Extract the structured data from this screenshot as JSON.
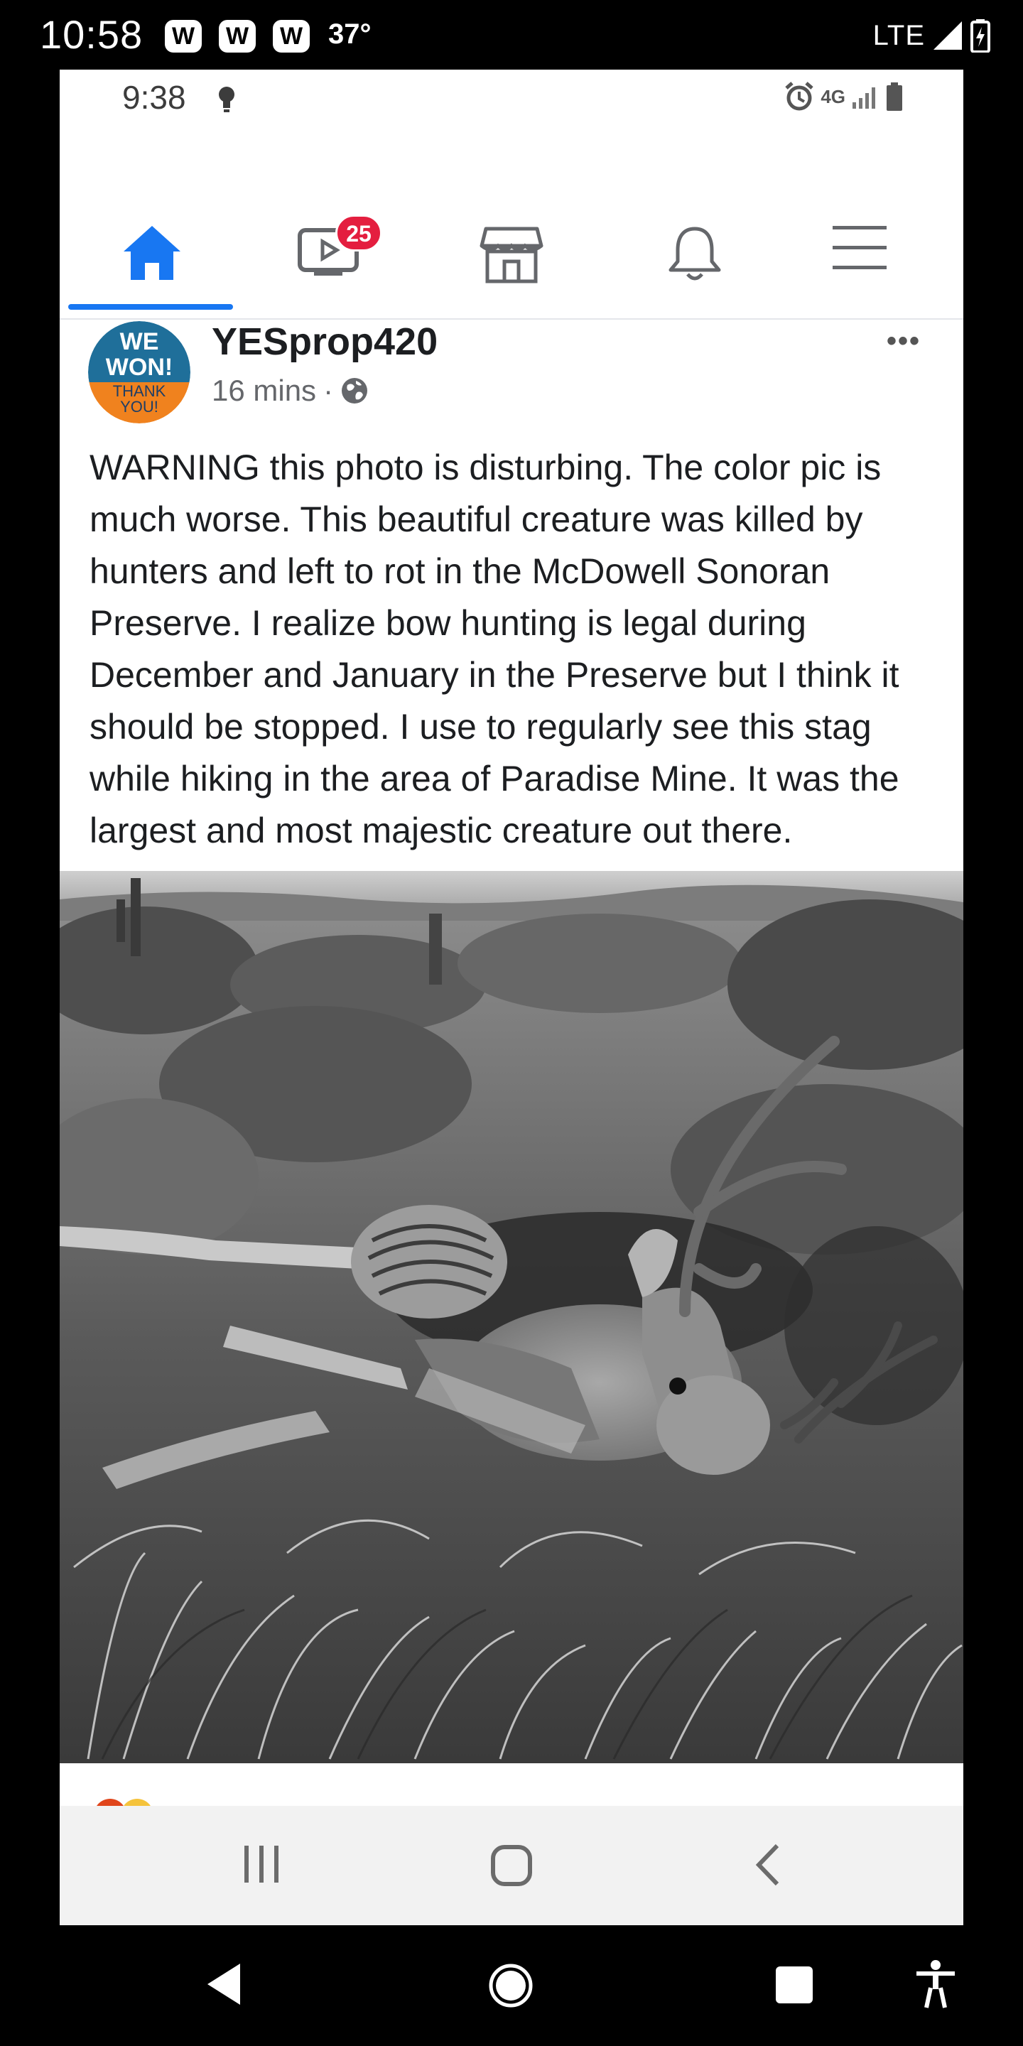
{
  "outer_status": {
    "time": "10:58",
    "badges": [
      "W",
      "W",
      "W"
    ],
    "temperature": "37°",
    "network": "LTE"
  },
  "inner_status": {
    "time": "9:38",
    "network_label": "4G"
  },
  "tabs": [
    {
      "name": "home",
      "icon": "home-icon",
      "active": true
    },
    {
      "name": "watch",
      "icon": "video-icon",
      "badge": "25"
    },
    {
      "name": "marketplace",
      "icon": "store-icon"
    },
    {
      "name": "notifications",
      "icon": "bell-icon"
    },
    {
      "name": "menu",
      "icon": "hamburger-icon"
    }
  ],
  "post": {
    "avatar_text": {
      "line1": "WE",
      "line2": "WON!",
      "line3": "THANK",
      "line4": "YOU!"
    },
    "author": "YESprop420",
    "time": "16 mins",
    "separator": "·",
    "more": "•••",
    "text": "WARNING this photo is disturbing. The color pic is much worse. This beautiful creature was killed by hunters and left to rot in the McDowell Sonoran Preserve. I realize bow hunting is legal during December and January in the Preserve but I think it should be stopped. I use to regularly see this stag while hiking in the area of Paradise Mine. It was the largest and most majestic creature out there."
  },
  "colors": {
    "facebook_blue": "#1877f2",
    "badge_red": "#e41e3f",
    "avatar_blue": "#1f6f9a",
    "avatar_orange": "#f0821e"
  }
}
